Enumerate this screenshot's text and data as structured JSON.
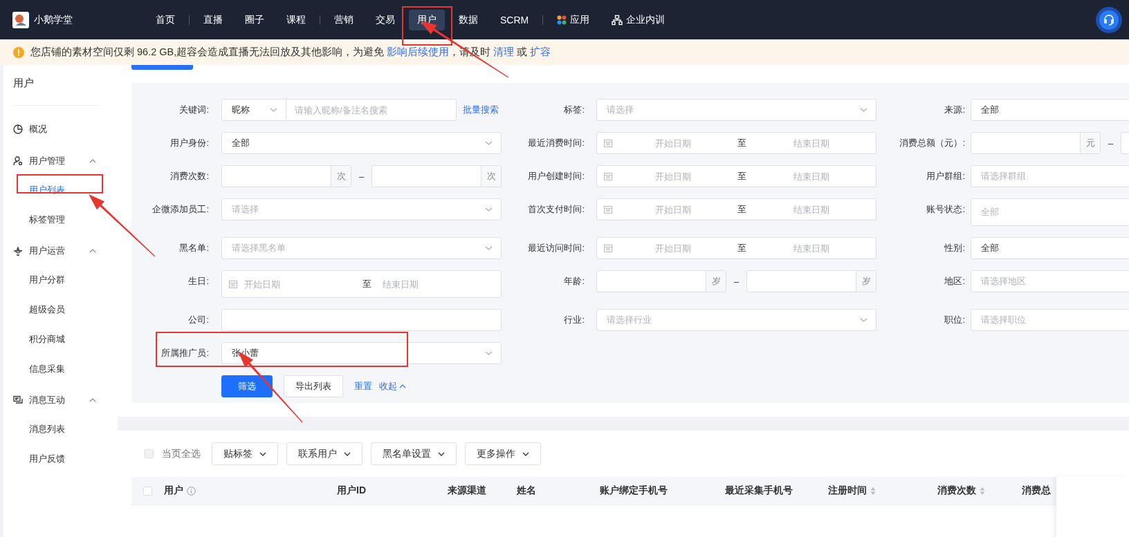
{
  "nav": {
    "brand": "小鹅学堂",
    "groups": [
      {
        "items": [
          {
            "label": "首页",
            "kind": "text",
            "selected": false
          }
        ]
      },
      {
        "items": [
          {
            "label": "直播",
            "kind": "text",
            "selected": false
          },
          {
            "label": "圈子",
            "kind": "text",
            "selected": false
          },
          {
            "label": "课程",
            "kind": "text",
            "selected": false
          }
        ]
      },
      {
        "items": [
          {
            "label": "营销",
            "kind": "text",
            "selected": false
          },
          {
            "label": "交易",
            "kind": "text",
            "selected": false
          },
          {
            "label": "用户",
            "kind": "text",
            "selected": true
          },
          {
            "label": "数据",
            "kind": "text",
            "selected": false
          },
          {
            "label": "SCRM",
            "kind": "text",
            "selected": false
          }
        ]
      },
      {
        "items": [
          {
            "label": "应用",
            "kind": "app_menu",
            "selected": false
          },
          {
            "label": "企业内训",
            "kind": "training_menu",
            "selected": false
          }
        ]
      }
    ]
  },
  "notice": {
    "segments": [
      {
        "kind": "text",
        "text": "您店铺的素材空间仅剩 96.2 GB,超容会造成直播无法回放及其他影响，为避免 "
      },
      {
        "kind": "link",
        "text": "影响后续使用"
      },
      {
        "kind": "text",
        "text": "，请及时 "
      },
      {
        "kind": "link",
        "text": "清理"
      },
      {
        "kind": "text",
        "text": " 或 "
      },
      {
        "kind": "link",
        "text": "扩容"
      }
    ]
  },
  "sidebar": {
    "title": "用户",
    "items": [
      {
        "kind": "link",
        "label": "概况",
        "selected": false
      },
      {
        "kind": "group",
        "label": "用户管理",
        "expanded": true,
        "children": [
          {
            "label": "用户列表",
            "selected": true
          },
          {
            "label": "标签管理",
            "selected": false
          }
        ]
      },
      {
        "kind": "group",
        "label": "用户运营",
        "expanded": true,
        "children": [
          {
            "label": "用户分群",
            "selected": false
          },
          {
            "label": "超级会员",
            "selected": false
          },
          {
            "label": "积分商城",
            "selected": false
          },
          {
            "label": "信息采集",
            "selected": false
          }
        ]
      },
      {
        "kind": "group",
        "label": "消息互动",
        "expanded": true,
        "children": [
          {
            "label": "消息列表",
            "selected": false
          },
          {
            "label": "用户反馈",
            "selected": false
          }
        ]
      }
    ]
  },
  "filter_form": {
    "fields": [
      {
        "label": "关键词:",
        "kind": "keyword",
        "select_value": "昵称",
        "placeholder": "请输入昵称/备注名搜索",
        "link": "批量搜索"
      },
      {
        "label": "标签:",
        "kind": "select",
        "placeholder": "请选择"
      },
      {
        "label": "来源:",
        "kind": "select",
        "value": "全部"
      },
      {
        "label": "用户身份:",
        "kind": "select",
        "value": "全部"
      },
      {
        "label": "最近消费时间:",
        "kind": "date_range",
        "start_placeholder": "开始日期",
        "separator": "至",
        "end_placeholder": "结束日期"
      },
      {
        "label": "消费总额（元）:",
        "kind": "number_range",
        "unit": "元",
        "dash": "–"
      },
      {
        "label": "消费次数:",
        "kind": "number_range",
        "unit": "次",
        "dash": "–",
        "second_unit": "次"
      },
      {
        "label": "用户创建时间:",
        "kind": "date_range",
        "start_placeholder": "开始日期",
        "separator": "至",
        "end_placeholder": "结束日期"
      },
      {
        "label": "用户群组:",
        "kind": "select",
        "placeholder": "请选择群组"
      },
      {
        "label": "企微添加员工:",
        "kind": "select",
        "placeholder": "请选择"
      },
      {
        "label": "首次支付时间:",
        "kind": "date_range",
        "start_placeholder": "开始日期",
        "separator": "至",
        "end_placeholder": "结束日期"
      },
      {
        "label": "账号状态:",
        "kind": "select",
        "placeholder": "全部"
      },
      {
        "label": "黑名单:",
        "kind": "select",
        "placeholder": "请选择黑名单"
      },
      {
        "label": "最近访问时间:",
        "kind": "date_range",
        "start_placeholder": "开始日期",
        "separator": "至",
        "end_placeholder": "结束日期"
      },
      {
        "label": "性别:",
        "kind": "select",
        "value": "全部"
      },
      {
        "label": "生日:",
        "kind": "date_range",
        "start_placeholder": "开始日期",
        "separator": "至",
        "end_placeholder": "结束日期"
      },
      {
        "label": "年龄:",
        "kind": "number_range",
        "unit": "岁",
        "dash": "–",
        "second_unit": "岁"
      },
      {
        "label": "地区:",
        "kind": "select",
        "placeholder": "请选择地区"
      },
      {
        "label": "公司:",
        "kind": "input"
      },
      {
        "label": "行业:",
        "kind": "select",
        "placeholder": "请选择行业"
      },
      {
        "label": "职位:",
        "kind": "select",
        "placeholder": "请选择职位"
      },
      {
        "label": "所属推广员:",
        "kind": "select",
        "value": "张小蕾"
      }
    ],
    "buttons": [
      {
        "label": "筛选",
        "kind": "primary"
      },
      {
        "label": "导出列表",
        "kind": "default"
      }
    ],
    "links": [
      {
        "label": "重置",
        "kind": "plain"
      },
      {
        "label": "收起",
        "kind": "collapse"
      }
    ]
  },
  "table": {
    "select_all": {
      "label": "当页全选",
      "checked": false,
      "disabled": true
    },
    "actions": [
      "贴标签",
      "联系用户",
      "黑名单设置",
      "更多操作"
    ],
    "header_checkbox": {
      "checked": false
    },
    "columns": [
      {
        "label": "用户",
        "info": true,
        "sortable": false
      },
      {
        "label": "用户ID",
        "info": false,
        "sortable": false
      },
      {
        "label": "来源渠道",
        "info": false,
        "sortable": false
      },
      {
        "label": "姓名",
        "info": false,
        "sortable": false
      },
      {
        "label": "账户绑定手机号",
        "info": false,
        "sortable": false
      },
      {
        "label": "最近采集手机号",
        "info": false,
        "sortable": false
      },
      {
        "label": "注册时间",
        "info": false,
        "sortable": true
      },
      {
        "label": "消费次数",
        "info": false,
        "sortable": true
      },
      {
        "label": "消费总",
        "info": false,
        "sortable": false
      }
    ]
  }
}
